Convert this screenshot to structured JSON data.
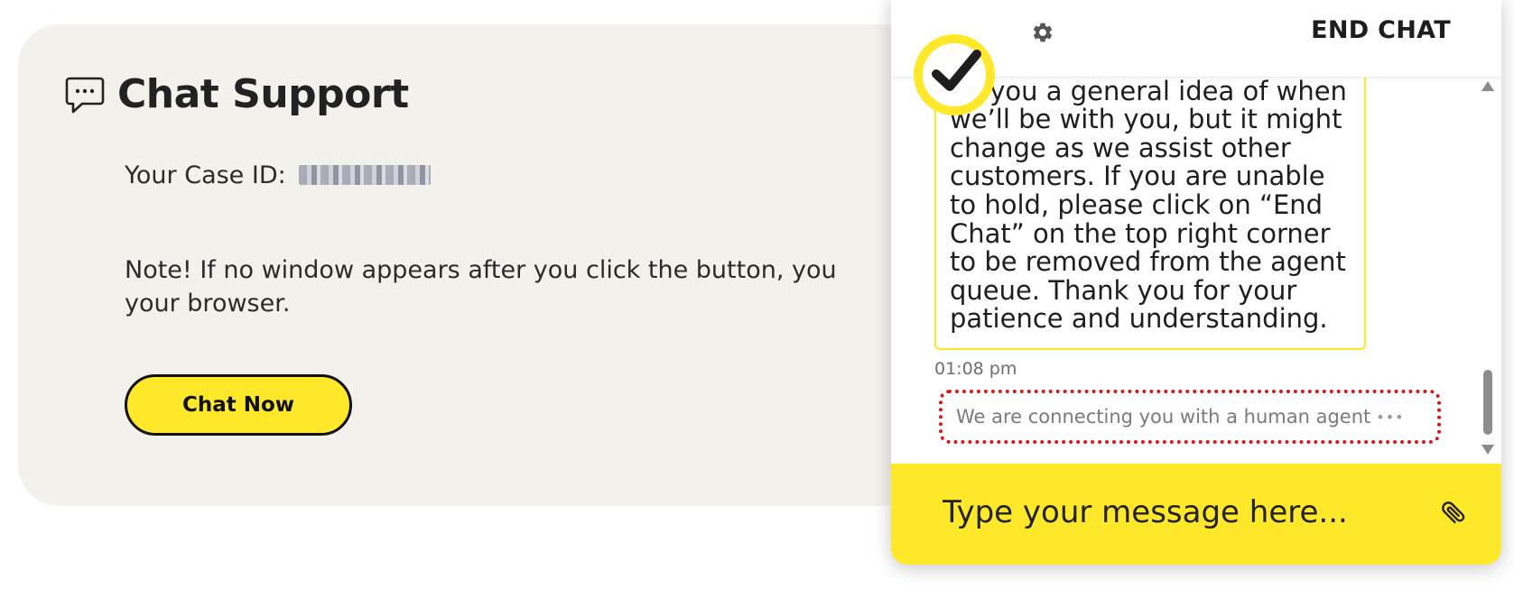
{
  "support": {
    "title": "Chat Support",
    "title_icon": "chat-bubble-icon",
    "case_label": "Your Case ID:",
    "case_id_redacted": true,
    "note": "Note! If no window appears after you click the button, you",
    "note_line2": "your browser.",
    "chat_now_label": "Chat Now"
  },
  "chat": {
    "settings_icon": "gear-icon",
    "end_chat_label": "END CHAT",
    "logo_icon": "checkmark-logo-icon",
    "message_text": "ve you a general idea of when we’ll be with you, but it might change as we assist other customers. If you are unable to hold, please click on “End Chat” on the top right corner to be removed from the agent queue. Thank you for your patience and understanding.",
    "message_time": "01:08 pm",
    "status_text": "We are connecting you with a human agent",
    "typing_indicator": "•••",
    "input_placeholder": "Type your message here...",
    "attach_icon": "paperclip-icon"
  },
  "colors": {
    "brand_yellow": "#ffe82a",
    "card_background": "#f3f1ec",
    "highlight_red": "#d21b1b"
  }
}
